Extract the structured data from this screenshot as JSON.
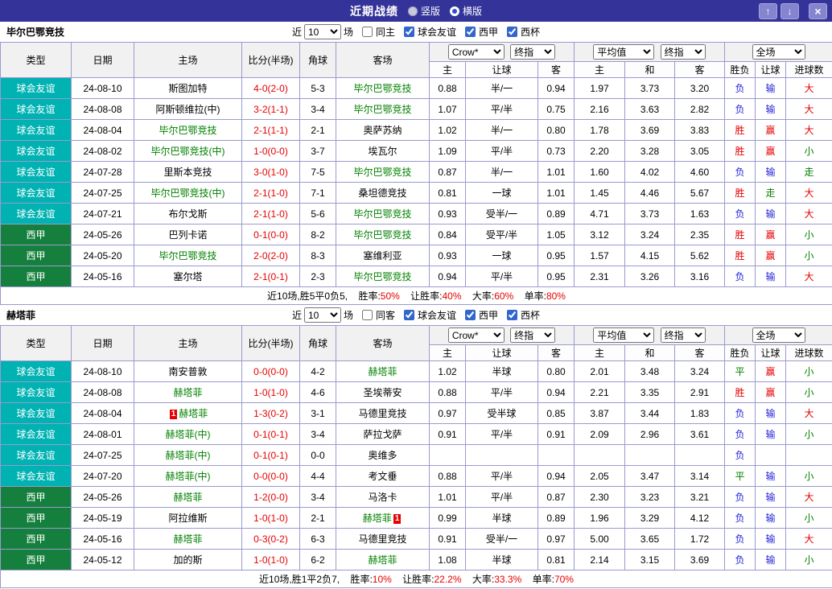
{
  "titlebar": {
    "title": "近期战绩",
    "vertical": "竖版",
    "horizontal": "横版",
    "up_icon": "↑",
    "down_icon": "↓",
    "close_icon": "×"
  },
  "labels": {
    "near": "近",
    "games": "场",
    "league_friendly": "球会友谊",
    "league_liga": "西甲",
    "league_cup": "西杯"
  },
  "selects": {
    "bookmaker": "Crow*",
    "final_index": "终指",
    "average": "平均值",
    "full_match": "全场"
  },
  "columns": {
    "type": "类型",
    "date": "日期",
    "home": "主场",
    "score": "比分(半场)",
    "corner": "角球",
    "away": "客场",
    "odds_home": "主",
    "odds_handicap": "让球",
    "odds_away": "客",
    "avg_home": "主",
    "avg_draw": "和",
    "avg_away": "客",
    "result": "胜负",
    "handicap_result": "让球",
    "goals": "进球数"
  },
  "colors": {
    "bar": "#333399",
    "friendly": "#00b2b2",
    "liga": "#15803d",
    "team_highlight": "#008000",
    "score": "#e60000",
    "win": "#e60000",
    "loss": "#2424d8",
    "draw": "#008000"
  },
  "sections": [
    {
      "team": "毕尔巴鄂竞技",
      "filter": {
        "count": "10",
        "same_label": "同主"
      },
      "rows": [
        {
          "league": "球会友谊",
          "date": "24-08-10",
          "home": {
            "n": "斯图加特"
          },
          "score": "4-0(2-0)",
          "corner": "5-3",
          "away": {
            "n": "毕尔巴鄂竞技",
            "hl": true
          },
          "o": [
            "0.88",
            "半/一",
            "0.94"
          ],
          "a": [
            "1.97",
            "3.73",
            "3.20"
          ],
          "r": [
            "负",
            "输",
            "大"
          ]
        },
        {
          "league": "球会友谊",
          "date": "24-08-08",
          "home": {
            "n": "阿斯顿维拉(中)"
          },
          "score": "3-2(1-1)",
          "corner": "3-4",
          "away": {
            "n": "毕尔巴鄂竞技",
            "hl": true
          },
          "o": [
            "1.07",
            "平/半",
            "0.75"
          ],
          "a": [
            "2.16",
            "3.63",
            "2.82"
          ],
          "r": [
            "负",
            "输",
            "大"
          ]
        },
        {
          "league": "球会友谊",
          "date": "24-08-04",
          "home": {
            "n": "毕尔巴鄂竞技",
            "hl": true
          },
          "score": "2-1(1-1)",
          "corner": "2-1",
          "away": {
            "n": "奥萨苏纳"
          },
          "o": [
            "1.02",
            "半/一",
            "0.80"
          ],
          "a": [
            "1.78",
            "3.69",
            "3.83"
          ],
          "r": [
            "胜",
            "赢",
            "大"
          ]
        },
        {
          "league": "球会友谊",
          "date": "24-08-02",
          "home": {
            "n": "毕尔巴鄂竞技(中)",
            "hl": true
          },
          "score": "1-0(0-0)",
          "corner": "3-7",
          "away": {
            "n": "埃瓦尔"
          },
          "o": [
            "1.09",
            "平/半",
            "0.73"
          ],
          "a": [
            "2.20",
            "3.28",
            "3.05"
          ],
          "r": [
            "胜",
            "赢",
            "小"
          ]
        },
        {
          "league": "球会友谊",
          "date": "24-07-28",
          "home": {
            "n": "里斯本竞技"
          },
          "score": "3-0(1-0)",
          "corner": "7-5",
          "away": {
            "n": "毕尔巴鄂竞技",
            "hl": true
          },
          "o": [
            "0.87",
            "半/一",
            "1.01"
          ],
          "a": [
            "1.60",
            "4.02",
            "4.60"
          ],
          "r": [
            "负",
            "输",
            "走"
          ]
        },
        {
          "league": "球会友谊",
          "date": "24-07-25",
          "home": {
            "n": "毕尔巴鄂竞技(中)",
            "hl": true
          },
          "score": "2-1(1-0)",
          "corner": "7-1",
          "away": {
            "n": "桑坦德竞技"
          },
          "o": [
            "0.81",
            "一球",
            "1.01"
          ],
          "a": [
            "1.45",
            "4.46",
            "5.67"
          ],
          "r": [
            "胜",
            "走",
            "大"
          ]
        },
        {
          "league": "球会友谊",
          "date": "24-07-21",
          "home": {
            "n": "布尔戈斯"
          },
          "score": "2-1(1-0)",
          "corner": "5-6",
          "away": {
            "n": "毕尔巴鄂竞技",
            "hl": true
          },
          "o": [
            "0.93",
            "受半/一",
            "0.89"
          ],
          "a": [
            "4.71",
            "3.73",
            "1.63"
          ],
          "r": [
            "负",
            "输",
            "大"
          ]
        },
        {
          "league": "西甲",
          "date": "24-05-26",
          "home": {
            "n": "巴列卡诺"
          },
          "score": "0-1(0-0)",
          "corner": "8-2",
          "away": {
            "n": "毕尔巴鄂竞技",
            "hl": true
          },
          "o": [
            "0.84",
            "受平/半",
            "1.05"
          ],
          "a": [
            "3.12",
            "3.24",
            "2.35"
          ],
          "r": [
            "胜",
            "赢",
            "小"
          ]
        },
        {
          "league": "西甲",
          "date": "24-05-20",
          "home": {
            "n": "毕尔巴鄂竞技",
            "hl": true
          },
          "score": "2-0(2-0)",
          "corner": "8-3",
          "away": {
            "n": "塞维利亚"
          },
          "o": [
            "0.93",
            "一球",
            "0.95"
          ],
          "a": [
            "1.57",
            "4.15",
            "5.62"
          ],
          "r": [
            "胜",
            "赢",
            "小"
          ]
        },
        {
          "league": "西甲",
          "date": "24-05-16",
          "home": {
            "n": "塞尔塔"
          },
          "score": "2-1(0-1)",
          "corner": "2-3",
          "away": {
            "n": "毕尔巴鄂竞技",
            "hl": true
          },
          "o": [
            "0.94",
            "平/半",
            "0.95"
          ],
          "a": [
            "2.31",
            "3.26",
            "3.16"
          ],
          "r": [
            "负",
            "输",
            "大"
          ]
        }
      ],
      "summary": {
        "record": "近10场,胜5平0负5,",
        "win_label": "胜率:",
        "win_value": "50%",
        "handicap_label": "让胜率:",
        "handicap_value": "40%",
        "big_label": "大率:",
        "big_value": "60%",
        "odd_label": "单率:",
        "odd_value": "80%"
      }
    },
    {
      "team": "赫塔菲",
      "filter": {
        "count": "10",
        "same_label": "同客"
      },
      "rows": [
        {
          "league": "球会友谊",
          "date": "24-08-10",
          "home": {
            "n": "南安普敦"
          },
          "score": "0-0(0-0)",
          "corner": "4-2",
          "away": {
            "n": "赫塔菲",
            "hl": true
          },
          "o": [
            "1.02",
            "半球",
            "0.80"
          ],
          "a": [
            "2.01",
            "3.48",
            "3.24"
          ],
          "r": [
            "平",
            "赢",
            "小"
          ]
        },
        {
          "league": "球会友谊",
          "date": "24-08-08",
          "home": {
            "n": "赫塔菲",
            "hl": true
          },
          "score": "1-0(1-0)",
          "corner": "4-6",
          "away": {
            "n": "圣埃蒂安"
          },
          "o": [
            "0.88",
            "平/半",
            "0.94"
          ],
          "a": [
            "2.21",
            "3.35",
            "2.91"
          ],
          "r": [
            "胜",
            "赢",
            "小"
          ]
        },
        {
          "league": "球会友谊",
          "date": "24-08-04",
          "home": {
            "n": "赫塔菲",
            "hl": true,
            "card": "1",
            "cardPos": "before"
          },
          "score": "1-3(0-2)",
          "corner": "3-1",
          "away": {
            "n": "马德里竞技"
          },
          "o": [
            "0.97",
            "受半球",
            "0.85"
          ],
          "a": [
            "3.87",
            "3.44",
            "1.83"
          ],
          "r": [
            "负",
            "输",
            "大"
          ]
        },
        {
          "league": "球会友谊",
          "date": "24-08-01",
          "home": {
            "n": "赫塔菲(中)",
            "hl": true
          },
          "score": "0-1(0-1)",
          "corner": "3-4",
          "away": {
            "n": "萨拉戈萨"
          },
          "o": [
            "0.91",
            "平/半",
            "0.91"
          ],
          "a": [
            "2.09",
            "2.96",
            "3.61"
          ],
          "r": [
            "负",
            "输",
            "小"
          ]
        },
        {
          "league": "球会友谊",
          "date": "24-07-25",
          "home": {
            "n": "赫塔菲(中)",
            "hl": true
          },
          "score": "0-1(0-1)",
          "corner": "0-0",
          "away": {
            "n": "奥维多"
          },
          "o": [
            "",
            "",
            ""
          ],
          "a": [
            "",
            "",
            ""
          ],
          "r": [
            "负",
            "",
            ""
          ]
        },
        {
          "league": "球会友谊",
          "date": "24-07-20",
          "home": {
            "n": "赫塔菲(中)",
            "hl": true
          },
          "score": "0-0(0-0)",
          "corner": "4-4",
          "away": {
            "n": "考文垂"
          },
          "o": [
            "0.88",
            "平/半",
            "0.94"
          ],
          "a": [
            "2.05",
            "3.47",
            "3.14"
          ],
          "r": [
            "平",
            "输",
            "小"
          ]
        },
        {
          "league": "西甲",
          "date": "24-05-26",
          "home": {
            "n": "赫塔菲",
            "hl": true
          },
          "score": "1-2(0-0)",
          "corner": "3-4",
          "away": {
            "n": "马洛卡"
          },
          "o": [
            "1.01",
            "平/半",
            "0.87"
          ],
          "a": [
            "2.30",
            "3.23",
            "3.21"
          ],
          "r": [
            "负",
            "输",
            "大"
          ]
        },
        {
          "league": "西甲",
          "date": "24-05-19",
          "home": {
            "n": "阿拉维斯"
          },
          "score": "1-0(1-0)",
          "corner": "2-1",
          "away": {
            "n": "赫塔菲",
            "hl": true,
            "card": "1",
            "cardPos": "after"
          },
          "o": [
            "0.99",
            "半球",
            "0.89"
          ],
          "a": [
            "1.96",
            "3.29",
            "4.12"
          ],
          "r": [
            "负",
            "输",
            "小"
          ]
        },
        {
          "league": "西甲",
          "date": "24-05-16",
          "home": {
            "n": "赫塔菲",
            "hl": true
          },
          "score": "0-3(0-2)",
          "corner": "6-3",
          "away": {
            "n": "马德里竞技"
          },
          "o": [
            "0.91",
            "受半/一",
            "0.97"
          ],
          "a": [
            "5.00",
            "3.65",
            "1.72"
          ],
          "r": [
            "负",
            "输",
            "大"
          ]
        },
        {
          "league": "西甲",
          "date": "24-05-12",
          "home": {
            "n": "加的斯"
          },
          "score": "1-0(1-0)",
          "corner": "6-2",
          "away": {
            "n": "赫塔菲",
            "hl": true
          },
          "o": [
            "1.08",
            "半球",
            "0.81"
          ],
          "a": [
            "2.14",
            "3.15",
            "3.69"
          ],
          "r": [
            "负",
            "输",
            "小"
          ]
        }
      ],
      "summary": {
        "record": "近10场,胜1平2负7,",
        "win_label": "胜率:",
        "win_value": "10%",
        "handicap_label": "让胜率:",
        "handicap_value": "22.2%",
        "big_label": "大率:",
        "big_value": "33.3%",
        "odd_label": "单率:",
        "odd_value": "70%"
      }
    }
  ]
}
